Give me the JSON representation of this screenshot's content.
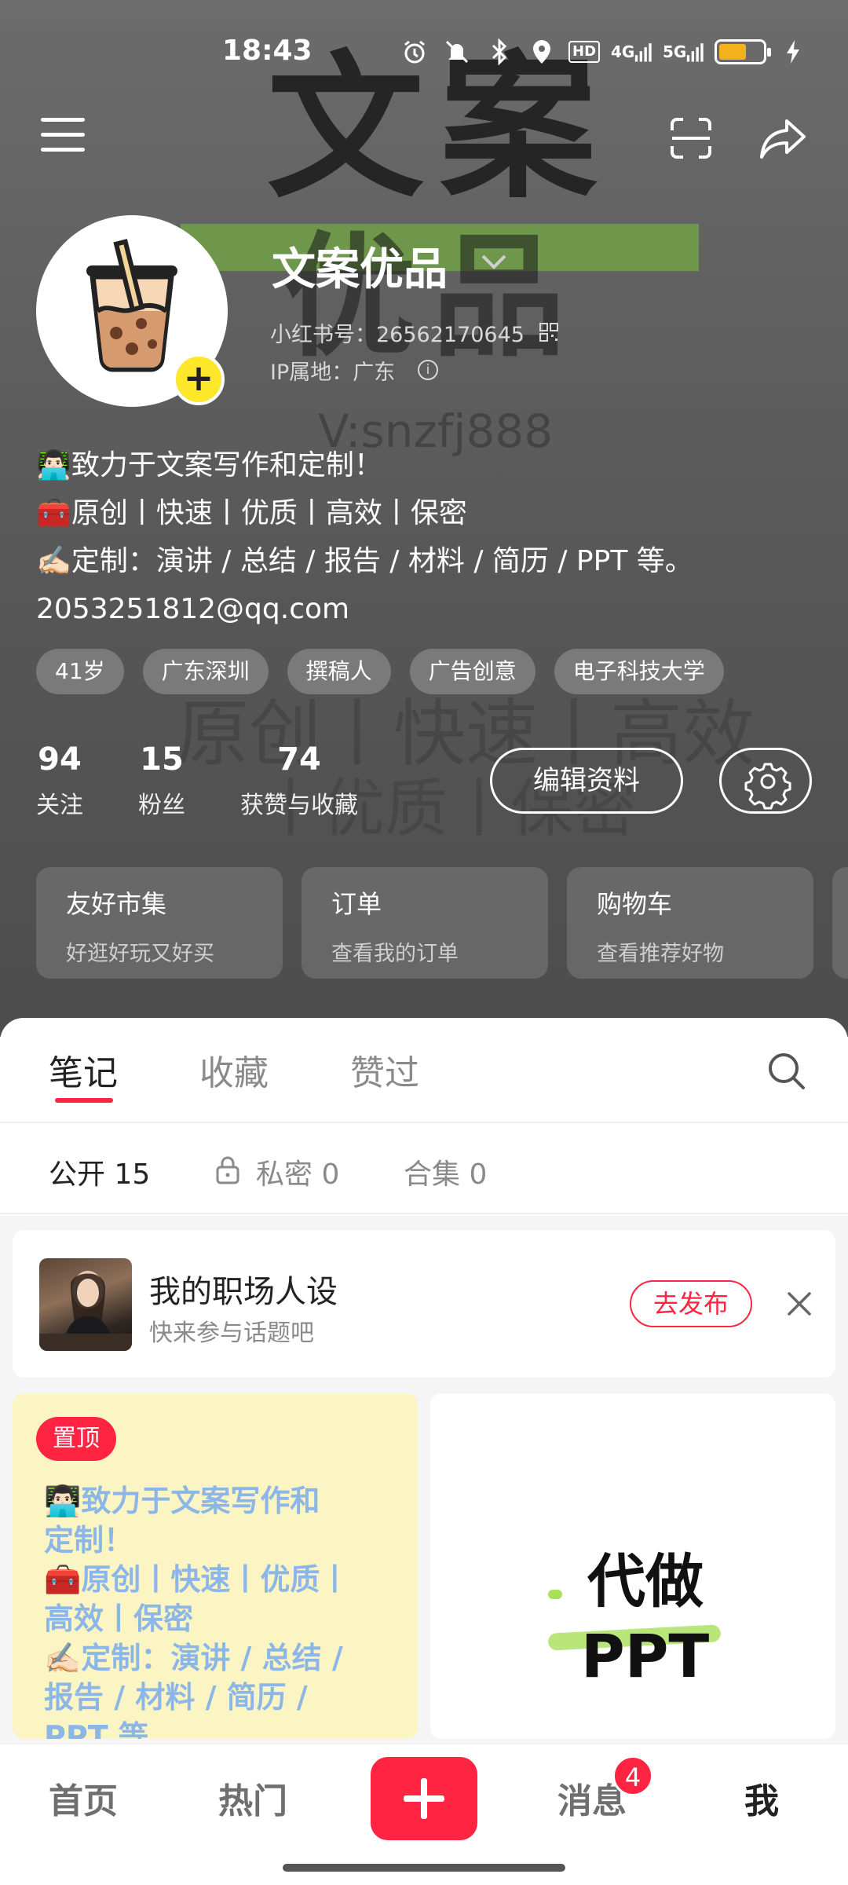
{
  "status_bar": {
    "time": "18:43",
    "icons": [
      "alarm-icon",
      "mute-icon",
      "bluetooth-icon",
      "location-icon",
      "hd-icon",
      "signal-4g-icon",
      "signal-5g-icon",
      "battery-icon",
      "charging-icon"
    ],
    "network_labels": [
      "4G",
      "5G"
    ],
    "hd_label": "HD",
    "battery_color": "#f3b21b"
  },
  "background_words": {
    "w1": "文案",
    "w2": "优品",
    "w3": "V:snzfj888",
    "w4": "原创丨快速丨高效",
    "w5": "丨优质丨保密"
  },
  "profile": {
    "name": "文案优品",
    "user_id": "小红书号：26562170645",
    "ip": "IP属地：广东",
    "bio": [
      "👨🏻‍💻致力于文案写作和定制！",
      "🧰原创丨快速丨优质丨高效丨保密",
      "✍🏻定制：演讲 / 总结 / 报告 / 材料 / 简历 / PPT  等。",
      "2053251812@qq.com"
    ],
    "tags": [
      "41岁",
      "广东深圳",
      "撰稿人",
      "广告创意",
      "电子科技大学"
    ],
    "stats": [
      {
        "num": "94",
        "label": "关注"
      },
      {
        "num": "15",
        "label": "粉丝"
      },
      {
        "num": "74",
        "label": "获赞与收藏"
      }
    ],
    "edit_label": "编辑资料"
  },
  "cards": [
    {
      "title": "友好市集",
      "sub": "好逛好玩又好买"
    },
    {
      "title": "订单",
      "sub": "查看我的订单"
    },
    {
      "title": "购物车",
      "sub": "查看推荐好物"
    }
  ],
  "tabs": [
    "笔记",
    "收藏",
    "赞过"
  ],
  "subtabs": [
    "公开 15",
    "私密 0",
    "合集 0"
  ],
  "prompt": {
    "title": "我的职场人设",
    "sub": "快来参与话题吧",
    "button": "去发布"
  },
  "notes": {
    "pinned_label": "置顶",
    "left_text": [
      "👨🏻‍💻致力于文案写作和",
      "定制！",
      "🧰原创丨快速丨优质丨",
      "高效丨保密",
      "✍🏻定制：演讲 / 总结 /",
      " 报告 / 材料 / 简历 /",
      "PPT 等"
    ],
    "right_title": "代做",
    "right_sub": "PPT"
  },
  "bottom_nav": {
    "items": [
      "首页",
      "热门",
      "消息",
      "我"
    ],
    "message_badge": "4"
  },
  "colors": {
    "accent": "#ff2442",
    "tag_bg": "rgba(255,255,255,0.22)",
    "note_text": "#8cb6e8"
  }
}
